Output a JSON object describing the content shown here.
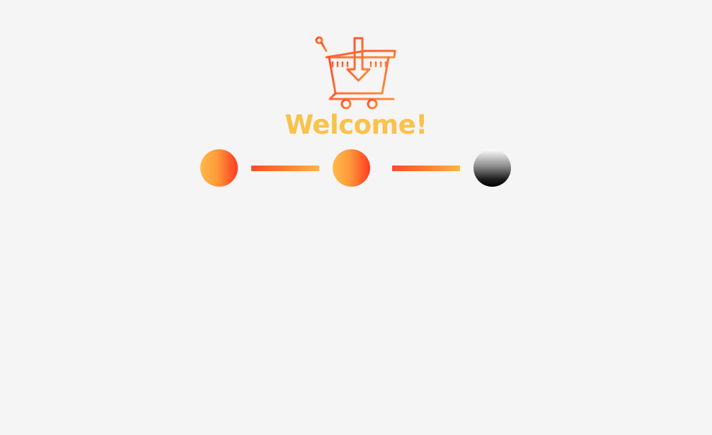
{
  "welcome": {
    "title": "Welcome!"
  },
  "logo": {
    "icon": "shopping-cart-download-icon",
    "gradient_from": "#ff4a2a",
    "gradient_to": "#ff8e3a"
  },
  "stepper": {
    "steps": [
      {
        "state": "complete"
      },
      {
        "state": "complete"
      },
      {
        "state": "pending"
      }
    ],
    "active_gradient": [
      "#ffb84a",
      "#ff3a22"
    ],
    "connector_gradient": [
      "#ff4a2a",
      "#ffb447"
    ]
  },
  "colors": {
    "background": "#f5f5f5",
    "title": "#f9c24a"
  }
}
